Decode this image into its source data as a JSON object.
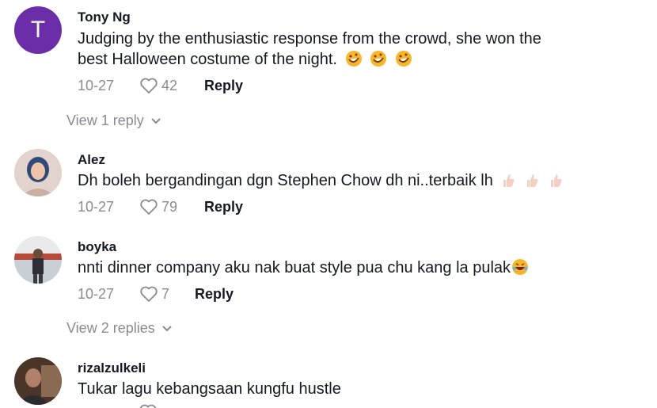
{
  "comments": [
    {
      "avatar_letter": "T",
      "username": "Tony Ng",
      "text_line1": "Judging by the enthusiastic response from the crowd, she won the",
      "text_line2": "best Halloween costume of the night.",
      "date": "10-27",
      "likes": "42",
      "reply_label": "Reply",
      "view_replies": "View 1 reply"
    },
    {
      "username": "Alez",
      "text": "Dh boleh bergandingan dgn Stephen Chow dh ni..terbaik lh",
      "date": "10-27",
      "likes": "79",
      "reply_label": "Reply"
    },
    {
      "username": "boyka",
      "text": "nnti dinner company aku nak buat style pua chu kang la pulak",
      "date": "10-27",
      "likes": "7",
      "reply_label": "Reply",
      "view_replies": "View 2 replies"
    },
    {
      "username": "rizalzulkeli",
      "text": "Tukar lagu kebangsaan kungfu hustle"
    }
  ]
}
